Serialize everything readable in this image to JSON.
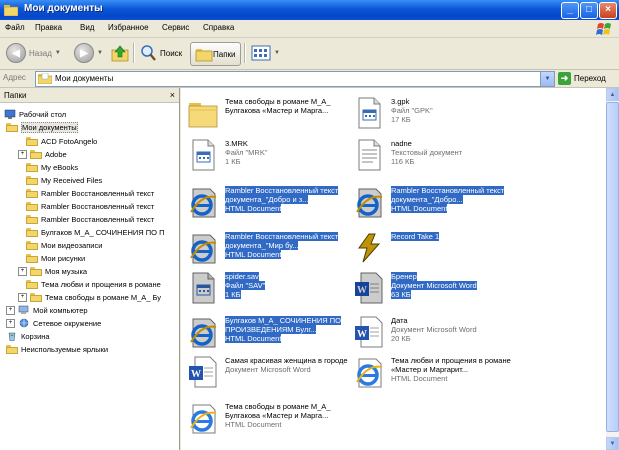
{
  "window": {
    "title": "Мои документы",
    "minimize_icon": "minimize-icon",
    "maximize_icon": "maximize-icon",
    "close_icon": "close-icon"
  },
  "menu": {
    "items": [
      "Файл",
      "Правка",
      "Вид",
      "Избранное",
      "Сервис",
      "Справка"
    ]
  },
  "toolbar": {
    "back_label": "Назад",
    "search_label": "Поиск",
    "folders_label": "Папки"
  },
  "address": {
    "label": "Адрес",
    "value": "Мои документы",
    "go_label": "Переход"
  },
  "folders_pane": {
    "title": "Папки",
    "close_icon": "close-icon",
    "tree": [
      {
        "label": "Рабочий стол",
        "icon": "desktop-icon"
      },
      {
        "label": "Мои документы",
        "icon": "my-documents-icon",
        "selected": true
      },
      {
        "label": "ACD FotoAngelo",
        "icon": "folder-icon"
      },
      {
        "label": "Adobe",
        "icon": "folder-icon",
        "expandable": true
      },
      {
        "label": "My eBooks",
        "icon": "folder-icon"
      },
      {
        "label": "My Received Files",
        "icon": "folder-icon"
      },
      {
        "label": "Rambler Восстановленный текст",
        "icon": "folder-icon"
      },
      {
        "label": "Rambler Восстановленный текст",
        "icon": "folder-icon"
      },
      {
        "label": "Rambler Восстановленный текст",
        "icon": "folder-icon"
      },
      {
        "label": "Булгаков М_А_ СОЧИНЕНИЯ ПО П",
        "icon": "folder-icon"
      },
      {
        "label": "Мои видеозаписи",
        "icon": "folder-icon"
      },
      {
        "label": "Мои рисунки",
        "icon": "folder-icon"
      },
      {
        "label": "Моя музыка",
        "icon": "music-folder-icon",
        "expandable": true
      },
      {
        "label": "Тема любви и прощения в романе",
        "icon": "folder-icon"
      },
      {
        "label": "Тема свободы в романе М_А_ Бу",
        "icon": "folder-icon",
        "expandable": true
      },
      {
        "label": "Мой компьютер",
        "icon": "computer-icon",
        "expandable": true
      },
      {
        "label": "Сетевое окружение",
        "icon": "network-icon",
        "expandable": true
      },
      {
        "label": "Корзина",
        "icon": "recycle-bin-icon"
      },
      {
        "label": "Неиспользуемые ярлыки",
        "icon": "folder-icon"
      }
    ]
  },
  "files": [
    {
      "name": "Тема свободы в романе М_А_ Булгакова «Мастер и Марга...",
      "type": "",
      "size": "",
      "icon": "folder-icon",
      "selected": false
    },
    {
      "name": "3.gpk",
      "type": "Файл \"GPK\"",
      "size": "17 КБ",
      "icon": "generic-file-icon",
      "selected": false
    },
    {
      "name": "3.MRK",
      "type": "Файл \"MRK\"",
      "size": "1 КБ",
      "icon": "generic-file-icon",
      "selected": false
    },
    {
      "name": "nadne",
      "type": "Текстовый документ",
      "size": "116 КБ",
      "icon": "text-document-icon",
      "selected": false
    },
    {
      "name": "Rambler Восстановленный текст документа_\"Добро и з...",
      "type": "HTML Document",
      "size": "",
      "icon": "ie-html-icon",
      "selected": true
    },
    {
      "name": "Rambler Восстановленный текст документа_\"Добро...",
      "type": "HTML Document",
      "size": "",
      "icon": "ie-html-icon",
      "selected": true
    },
    {
      "name": "Rambler Восстановленный текст документа_\"Мир бу...",
      "type": "HTML Document",
      "size": "",
      "icon": "ie-html-icon",
      "selected": true
    },
    {
      "name": "Record Take 1",
      "type": "",
      "size": "",
      "icon": "winamp-icon",
      "selected": true
    },
    {
      "name": "spider.sav",
      "type": "Файл \"SAV\"",
      "size": "1 КБ",
      "icon": "generic-file-icon",
      "selected": true
    },
    {
      "name": "Бренер",
      "type": "Документ Microsoft Word",
      "size": "63 КБ",
      "icon": "word-document-icon",
      "selected": true
    },
    {
      "name": "Булгаков М_А_ СОЧИНЕНИЯ ПО ПРОИЗВЕДЕНИЯМ Булг...",
      "type": "HTML Document",
      "size": "",
      "icon": "ie-html-icon",
      "selected": true
    },
    {
      "name": "Дата",
      "type": "Документ Microsoft Word",
      "size": "20 КБ",
      "icon": "word-document-icon",
      "selected": false
    },
    {
      "name": "Самая красивая женщина в городе",
      "type": "Документ Microsoft Word",
      "size": "",
      "icon": "word-document-icon",
      "selected": false
    },
    {
      "name": "Тема любви и прощения в романе «Мастер и Маргарит...",
      "type": "HTML Document",
      "size": "",
      "icon": "ie-html-icon",
      "selected": false
    },
    {
      "name": "Тема свободы в романе М_А_ Булгакова «Мастер и Марга...",
      "type": "HTML Document",
      "size": "",
      "icon": "ie-html-icon",
      "selected": false
    }
  ],
  "colors": {
    "titlebar": "#0a56d8",
    "selection": "#316ac5",
    "window_bg": "#ece9d8"
  }
}
